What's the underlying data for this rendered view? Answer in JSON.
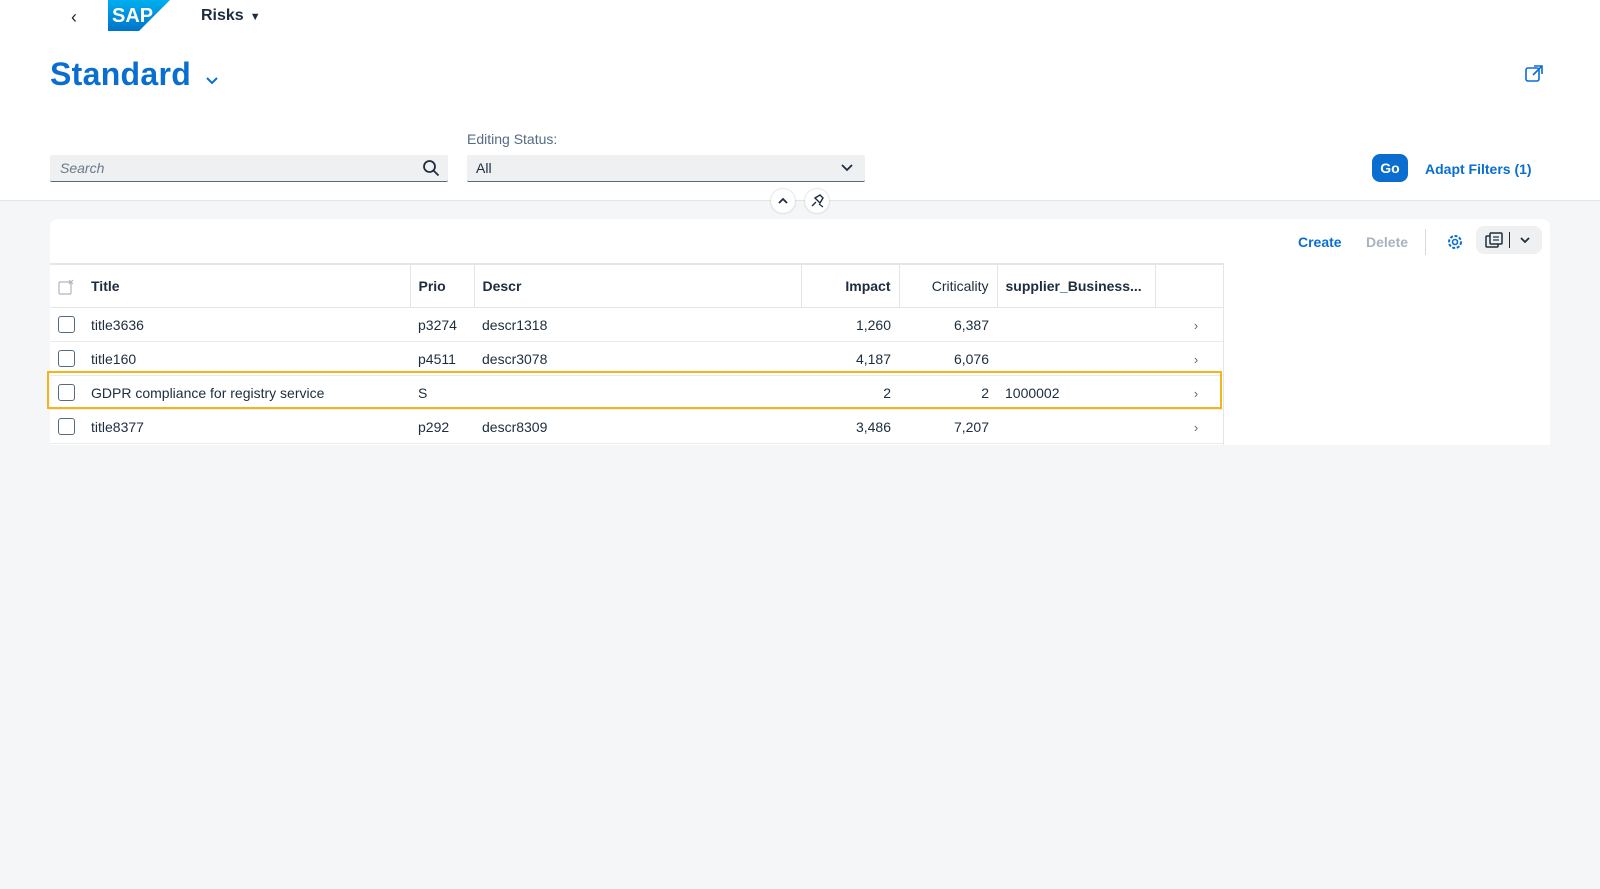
{
  "shell": {
    "logo_text": "SAP",
    "app_title": "Risks"
  },
  "header": {
    "variant_title": "Standard"
  },
  "filters": {
    "search_placeholder": "Search",
    "editing_status_label": "Editing Status:",
    "editing_status_value": "All",
    "go_label": "Go",
    "adapt_filters_label": "Adapt Filters (1)"
  },
  "toolbar": {
    "create_label": "Create",
    "delete_label": "Delete"
  },
  "table": {
    "columns": {
      "title": "Title",
      "prio": "Prio",
      "descr": "Descr",
      "impact": "Impact",
      "criticality": "Criticality",
      "supplier": "supplier_Business..."
    },
    "rows": [
      {
        "title": "title3636",
        "prio": "p3274",
        "descr": "descr1318",
        "impact": "1,260",
        "criticality": "6,387",
        "supplier": ""
      },
      {
        "title": "title160",
        "prio": "p4511",
        "descr": "descr3078",
        "impact": "4,187",
        "criticality": "6,076",
        "supplier": ""
      },
      {
        "title": "GDPR compliance for registry service",
        "prio": "S",
        "descr": "",
        "impact": "2",
        "criticality": "2",
        "supplier": "1000002"
      },
      {
        "title": "title8377",
        "prio": "p292",
        "descr": "descr8309",
        "impact": "3,486",
        "criticality": "7,207",
        "supplier": ""
      }
    ]
  },
  "colors": {
    "brand_blue": "#0a6ed1",
    "highlight": "#f5b41a"
  },
  "icons": [
    "back-icon",
    "chevron-down-icon",
    "share-icon",
    "search-icon",
    "collapse-icon",
    "pin-icon",
    "settings-icon",
    "export-icon",
    "row-navigation-icon"
  ]
}
